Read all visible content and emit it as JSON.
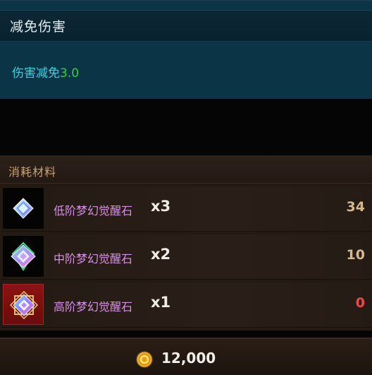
{
  "effect": {
    "title": "减免伤害",
    "stat_label": "伤害减免",
    "stat_value": "3.0"
  },
  "materials": {
    "title": "消耗材料",
    "items": [
      {
        "name": "低阶梦幻觉醒石",
        "quantity": "x3",
        "owned": "34",
        "icon": "low-tier-dream-awakening-stone-icon",
        "sufficient": true
      },
      {
        "name": "中阶梦幻觉醒石",
        "quantity": "x2",
        "owned": "10",
        "icon": "mid-tier-dream-awakening-stone-icon",
        "sufficient": true
      },
      {
        "name": "高阶梦幻觉醒石",
        "quantity": "x1",
        "owned": "0",
        "icon": "high-tier-dream-awakening-stone-icon",
        "sufficient": false
      }
    ]
  },
  "cost": {
    "icon": "gold-coin-icon",
    "amount": "12,000"
  },
  "colors": {
    "effect_panel_bg": "#0b3547",
    "stat_label": "#3cd0e0",
    "stat_value": "#33d23a",
    "material_name": "#d88fe8",
    "owned_sufficient": "#d6b98e",
    "owned_insufficient": "#f04848",
    "rare_icon_bg": "#8c1212"
  }
}
